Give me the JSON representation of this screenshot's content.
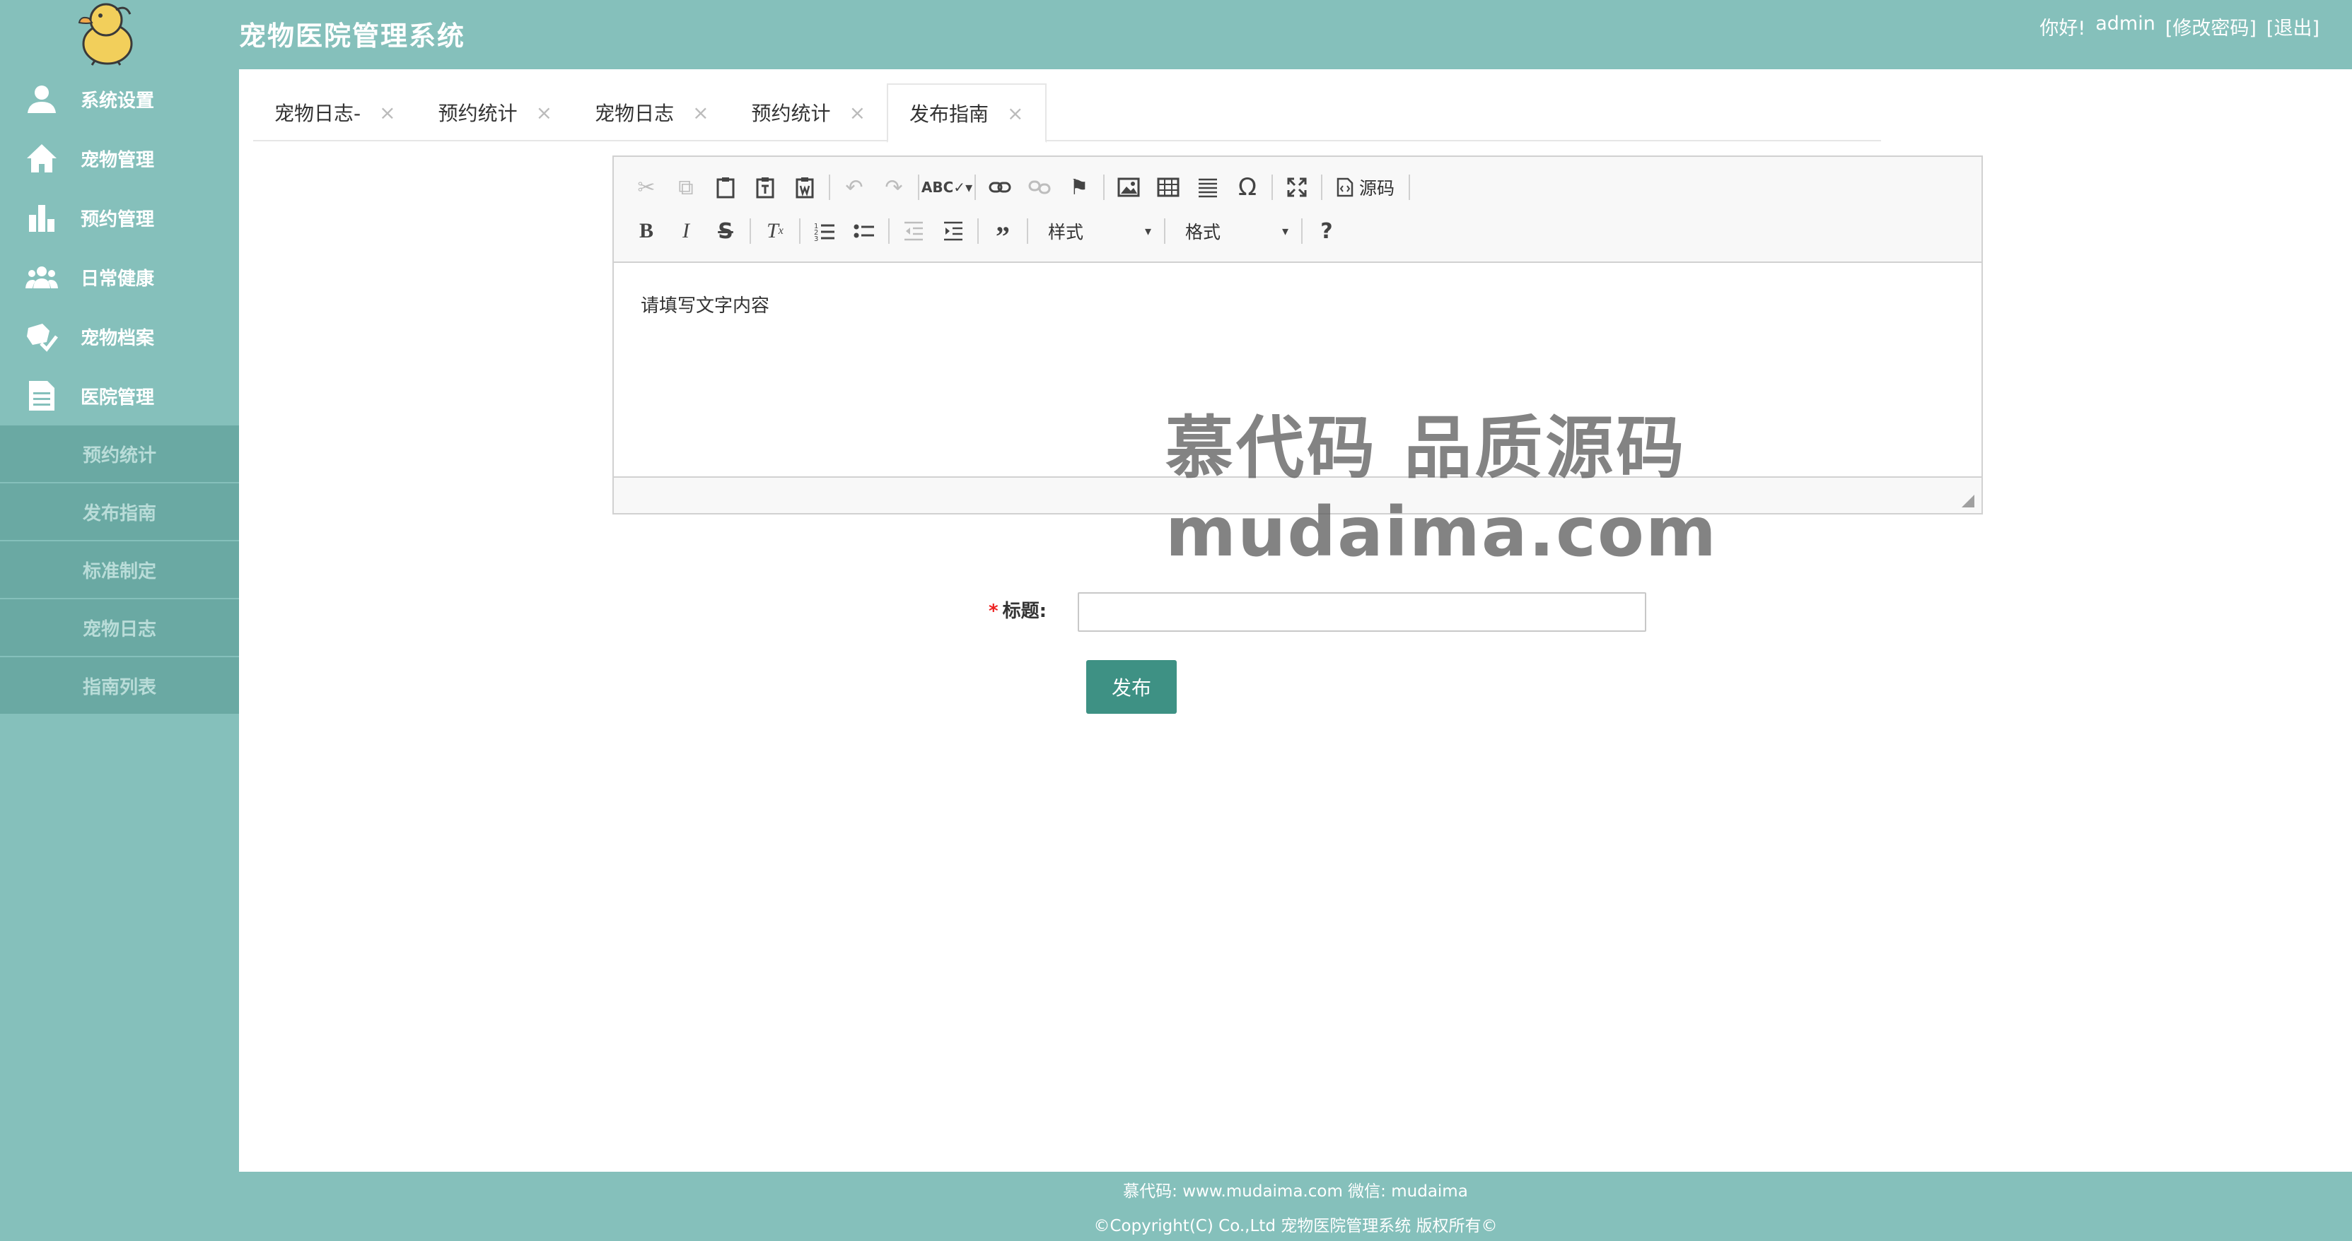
{
  "header": {
    "title": "宠物医院管理系统",
    "greeting": "你好!",
    "username": "admin",
    "change_password": "[修改密码]",
    "logout": "[退出]"
  },
  "sidebar": {
    "items": [
      {
        "label": "系统设置",
        "icon": "user-icon"
      },
      {
        "label": "宠物管理",
        "icon": "home-icon"
      },
      {
        "label": "预约管理",
        "icon": "bar-chart-icon"
      },
      {
        "label": "日常健康",
        "icon": "users-icon"
      },
      {
        "label": "宠物档案",
        "icon": "paw-check-icon"
      },
      {
        "label": "医院管理",
        "icon": "document-icon"
      }
    ],
    "subitems": [
      "预约统计",
      "发布指南",
      "标准制定",
      "宠物日志",
      "指南列表"
    ]
  },
  "tabs": [
    {
      "label": "宠物日志-",
      "active": false
    },
    {
      "label": "预约统计",
      "active": false
    },
    {
      "label": "宠物日志",
      "active": false
    },
    {
      "label": "预约统计",
      "active": false
    },
    {
      "label": "发布指南",
      "active": true
    }
  ],
  "editor": {
    "source_label": "源码",
    "style_combo": "样式",
    "format_combo": "格式",
    "content": "请填写文字内容"
  },
  "watermark": {
    "line1": "慕代码 品质源码",
    "line2": "mudaima.com"
  },
  "form": {
    "title_label": "标题:",
    "title_value": "",
    "publish_label": "发布"
  },
  "footer": {
    "line1": "慕代码: www.mudaima.com 微信: mudaima",
    "line2": "©Copyright(C) Co.,Ltd 宠物医院管理系统 版权所有©"
  },
  "colors": {
    "theme": "#85c0bb",
    "submenu": "#6aa9a3",
    "button": "#3e9184"
  }
}
